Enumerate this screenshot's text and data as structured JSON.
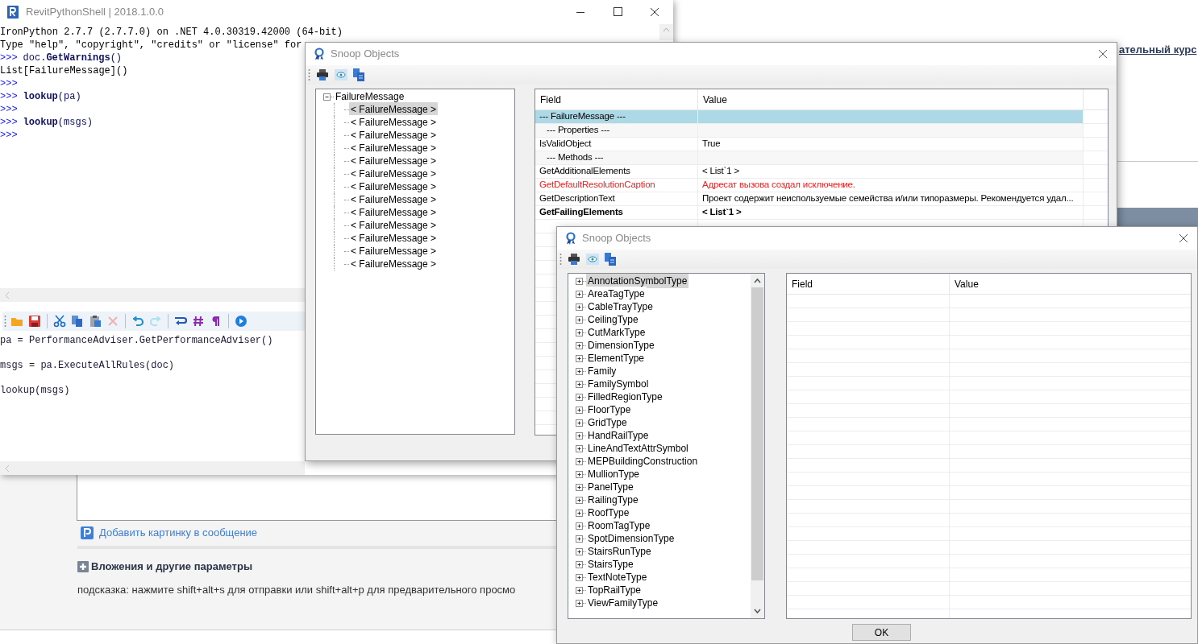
{
  "background_page": {
    "course_link": "ательный курс",
    "add_image_link": "Добавить картинку в сообщение",
    "attachments_heading": "Вложения и другие параметры",
    "hint": "подсказка: нажмите shift+alt+s для отправки или shift+alt+p для предварительного просмо"
  },
  "shell_window": {
    "title": "RevitPythonShell | 2018.1.0.0",
    "console_lines": [
      {
        "kind": "output",
        "text": "IronPython 2.7.7 (2.7.7.0) on .NET 4.0.30319.42000 (64-bit)"
      },
      {
        "kind": "output",
        "text": "Type \"help\", \"copyright\", \"credits\" or \"license\" for"
      },
      {
        "kind": "input",
        "prompt": ">>>",
        "code": "doc.**GetWarnings**()"
      },
      {
        "kind": "output",
        "text": "List[FailureMessage]()"
      },
      {
        "kind": "input",
        "prompt": ">>>"
      },
      {
        "kind": "input",
        "prompt": ">>>",
        "code": "**lookup**(pa)"
      },
      {
        "kind": "input",
        "prompt": ">>>"
      },
      {
        "kind": "input",
        "prompt": ">>>",
        "code": "**lookup**(msgs)"
      },
      {
        "kind": "input",
        "prompt": ">>>"
      }
    ],
    "editor_toolbar": [
      {
        "kind": "open",
        "disabled": false
      },
      {
        "kind": "save",
        "disabled": false
      },
      {
        "kind": "sep"
      },
      {
        "kind": "cut",
        "disabled": false
      },
      {
        "kind": "copy",
        "disabled": false
      },
      {
        "kind": "paste",
        "disabled": false
      },
      {
        "kind": "delete",
        "disabled": true
      },
      {
        "kind": "sep"
      },
      {
        "kind": "undo",
        "disabled": false
      },
      {
        "kind": "redo",
        "disabled": true
      },
      {
        "kind": "sep"
      },
      {
        "kind": "wrap",
        "disabled": false
      },
      {
        "kind": "hash",
        "disabled": false
      },
      {
        "kind": "pilcrow",
        "disabled": false
      },
      {
        "kind": "sep"
      },
      {
        "kind": "run",
        "disabled": false
      }
    ],
    "editor_lines": [
      "pa = PerformanceAdviser.GetPerformanceAdviser()",
      "msgs = pa.ExecuteAllRules(doc)",
      "lookup(msgs)"
    ]
  },
  "snoop_windows": [
    {
      "title": "Snoop Objects",
      "tree": [
        {
          "label": "FailureMessage",
          "expanded": true,
          "selected": false,
          "children": [
            {
              "label": "< FailureMessage >",
              "selected": true
            },
            {
              "label": "< FailureMessage >",
              "selected": false
            },
            {
              "label": "< FailureMessage >",
              "selected": false
            },
            {
              "label": "< FailureMessage >",
              "selected": false
            },
            {
              "label": "< FailureMessage >",
              "selected": false
            },
            {
              "label": "< FailureMessage >",
              "selected": false
            },
            {
              "label": "< FailureMessage >",
              "selected": false
            },
            {
              "label": "< FailureMessage >",
              "selected": false
            },
            {
              "label": "< FailureMessage >",
              "selected": false
            },
            {
              "label": "< FailureMessage >",
              "selected": false
            },
            {
              "label": "< FailureMessage >",
              "selected": false
            },
            {
              "label": "< FailureMessage >",
              "selected": false
            },
            {
              "label": "< FailureMessage >",
              "selected": false
            }
          ]
        }
      ],
      "grid": {
        "columns": [
          "Field",
          "Value"
        ],
        "rows": [
          {
            "kind": "section",
            "field": "--- FailureMessage ---",
            "selected": true
          },
          {
            "kind": "subsection",
            "field": "--- Properties ---",
            "selected": false
          },
          {
            "kind": "normal",
            "field": "IsValidObject",
            "value": "True",
            "selected": false
          },
          {
            "kind": "subsection",
            "field": "--- Methods ---",
            "selected": false
          },
          {
            "kind": "normal",
            "field": "GetAdditionalElements",
            "value": "< List`1 >",
            "selected": false
          },
          {
            "kind": "error",
            "field": "GetDefaultResolutionCaption",
            "value": "Адресат вызова создал исключение.",
            "selected": false
          },
          {
            "kind": "normal",
            "field": "GetDescriptionText",
            "value": "Проект содержит неиспользуемые семейства и/или типоразмеры. Рекомендуется удал...",
            "selected": false
          },
          {
            "kind": "bold",
            "field": "GetFailingElements",
            "value": "< List`1 >",
            "selected": false
          }
        ]
      }
    },
    {
      "title": "Snoop Objects",
      "tree": [
        {
          "label": "AnnotationSymbolType",
          "expanded": false,
          "selected": true
        },
        {
          "label": "AreaTagType",
          "expanded": false,
          "selected": false
        },
        {
          "label": "CableTrayType",
          "expanded": false,
          "selected": false
        },
        {
          "label": "CeilingType",
          "expanded": false,
          "selected": false
        },
        {
          "label": "CutMarkType",
          "expanded": false,
          "selected": false
        },
        {
          "label": "DimensionType",
          "expanded": false,
          "selected": false
        },
        {
          "label": "ElementType",
          "expanded": false,
          "selected": false
        },
        {
          "label": "Family",
          "expanded": false,
          "selected": false
        },
        {
          "label": "FamilySymbol",
          "expanded": false,
          "selected": false
        },
        {
          "label": "FilledRegionType",
          "expanded": false,
          "selected": false
        },
        {
          "label": "FloorType",
          "expanded": false,
          "selected": false
        },
        {
          "label": "GridType",
          "expanded": false,
          "selected": false
        },
        {
          "label": "HandRailType",
          "expanded": false,
          "selected": false
        },
        {
          "label": "LineAndTextAttrSymbol",
          "expanded": false,
          "selected": false
        },
        {
          "label": "MEPBuildingConstruction",
          "expanded": false,
          "selected": false
        },
        {
          "label": "MullionType",
          "expanded": false,
          "selected": false
        },
        {
          "label": "PanelType",
          "expanded": false,
          "selected": false
        },
        {
          "label": "RailingType",
          "expanded": false,
          "selected": false
        },
        {
          "label": "RoofType",
          "expanded": false,
          "selected": false
        },
        {
          "label": "RoomTagType",
          "expanded": false,
          "selected": false
        },
        {
          "label": "SpotDimensionType",
          "expanded": false,
          "selected": false
        },
        {
          "label": "StairsRunType",
          "expanded": false,
          "selected": false
        },
        {
          "label": "StairsType",
          "expanded": false,
          "selected": false
        },
        {
          "label": "TextNoteType",
          "expanded": false,
          "selected": false
        },
        {
          "label": "TopRailType",
          "expanded": false,
          "selected": false
        },
        {
          "label": "ViewFamilyType",
          "expanded": false,
          "selected": false
        }
      ],
      "grid": {
        "columns": [
          "Field",
          "Value"
        ]
      },
      "ok_button": "OK"
    }
  ]
}
